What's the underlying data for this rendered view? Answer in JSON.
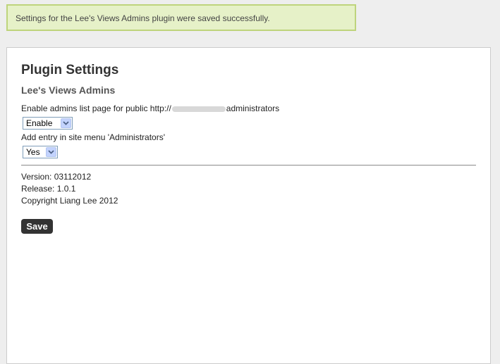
{
  "notice": {
    "message": "Settings for the Lee's Views Admins plugin were saved successfully."
  },
  "panel": {
    "title": "Plugin Settings",
    "subtitle": "Lee's Views Admins",
    "field1": {
      "label_prefix": "Enable admins list page for public http://",
      "label_suffix": "administrators",
      "value": "Enable"
    },
    "field2": {
      "label": "Add entry in site menu 'Administrators'",
      "value": "Yes"
    },
    "info": {
      "version": "Version: 03112012",
      "release": "Release: 1.0.1",
      "copyright": "Copyright Liang Lee 2012"
    },
    "save_label": "Save"
  },
  "colors": {
    "notice_bg": "#e6f1c8",
    "notice_border": "#bed47c",
    "save_bg": "#333333"
  }
}
